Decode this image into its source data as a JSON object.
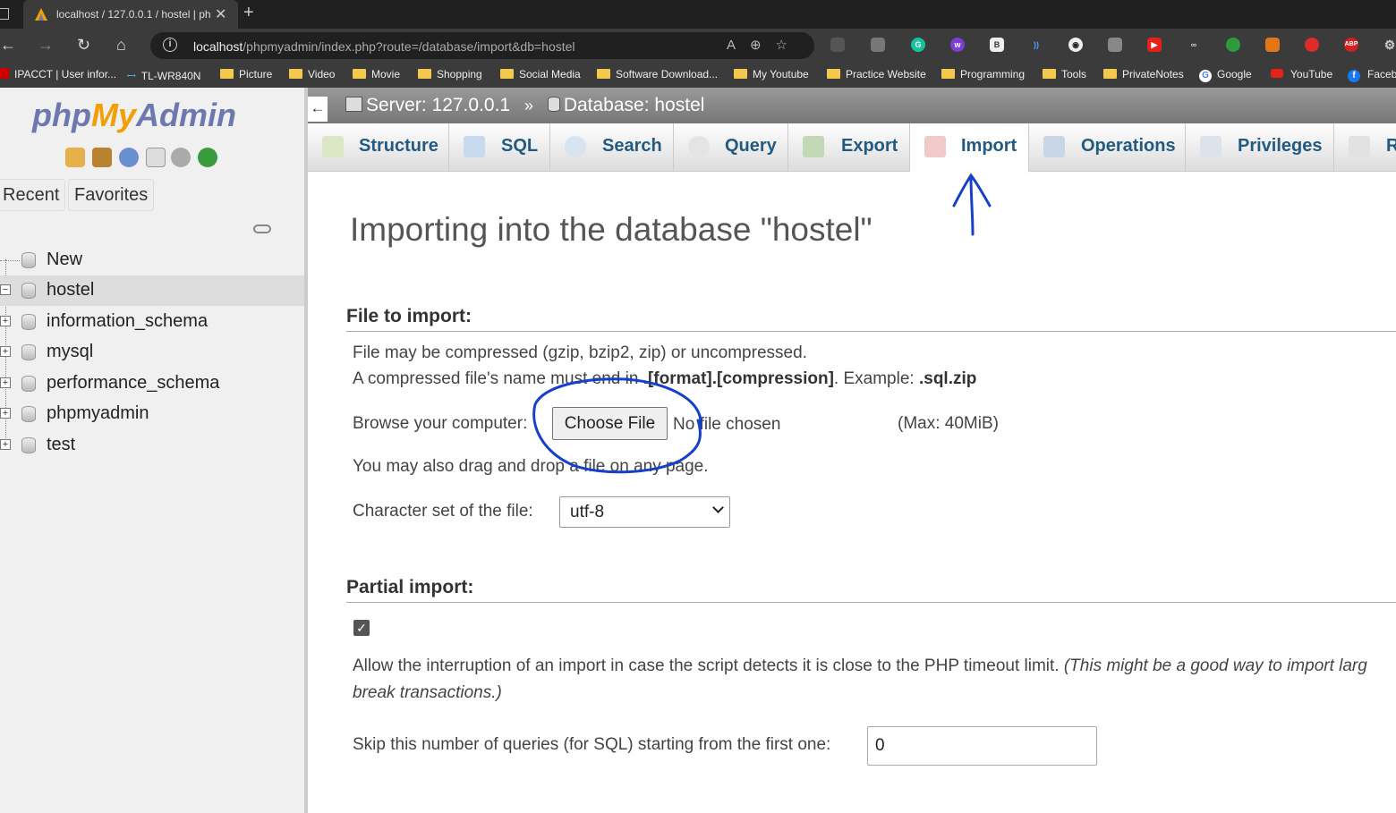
{
  "browser": {
    "tab_title": "localhost / 127.0.0.1 / hostel | ph",
    "url_host": "localhost",
    "url_path": "/phpmyadmin/index.php?route=/database/import&db=hostel",
    "bookmarks": [
      "IPACCT | User infor...",
      "TL-WR840N",
      "Picture",
      "Video",
      "Movie",
      "Shopping",
      "Social Media",
      "Software Download...",
      "My Youtube",
      "Practice Website",
      "Programming",
      "Tools",
      "PrivateNotes",
      "Google",
      "YouTube",
      "Faceb"
    ]
  },
  "sidebar": {
    "logo_php": "php",
    "logo_my": "My",
    "logo_admin": "Admin",
    "tabs": [
      "Recent",
      "Favorites"
    ],
    "tree": [
      {
        "label": "New",
        "expander": ""
      },
      {
        "label": "hostel",
        "expander": "−"
      },
      {
        "label": "information_schema",
        "expander": "+"
      },
      {
        "label": "mysql",
        "expander": "+"
      },
      {
        "label": "performance_schema",
        "expander": "+"
      },
      {
        "label": "phpmyadmin",
        "expander": "+"
      },
      {
        "label": "test",
        "expander": "+"
      }
    ]
  },
  "breadcrumb": {
    "server": "Server: 127.0.0.1",
    "separator": "»",
    "database": "Database: hostel",
    "back": "←"
  },
  "tabs": [
    "Structure",
    "SQL",
    "Search",
    "Query",
    "Export",
    "Import",
    "Operations",
    "Privileges",
    "R"
  ],
  "active_tab": "Import",
  "page": {
    "title": "Importing into the database \"hostel\"",
    "file_section": "File to import:",
    "compress_note": "File may be compressed (gzip, bzip2, zip) or uncompressed.",
    "name_note_pre": "A compressed file's name must end in ",
    "name_note_format": ".[format].[compression]",
    "name_note_mid": ". Example: ",
    "name_note_example": ".sql.zip",
    "browse_label": "Browse your computer:",
    "choose_button": "Choose File",
    "no_file": "No file chosen",
    "max_size": "(Max: 40MiB)",
    "drag_note": "You may also drag and drop a file on any page.",
    "charset_label": "Character set of the file:",
    "charset_value": "utf-8",
    "partial_section": "Partial import:",
    "allow_text": "Allow the interruption of an import in case the script detects it is close to the PHP timeout limit. ",
    "allow_italic_1": "(This might be a good way to import larg",
    "allow_italic_2": "break transactions.)",
    "skip_label": "Skip this number of queries (for SQL) starting from the first one:",
    "skip_value": "0"
  },
  "colors": {
    "accent_link": "#235a81",
    "annotation_pen": "#1540c8"
  }
}
